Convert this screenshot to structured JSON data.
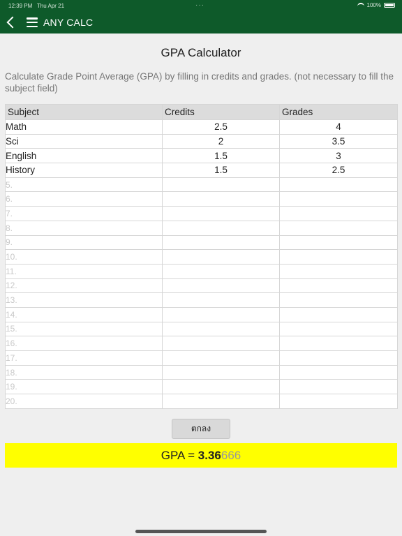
{
  "status": {
    "time": "12:39 PM",
    "date": "Thu Apr 21",
    "dots": "···",
    "battery": "100%"
  },
  "nav": {
    "title": "ANY CALC",
    "icons": [
      "back-icon",
      "menu-icon"
    ]
  },
  "page": {
    "title": "GPA Calculator",
    "description": "Calculate Grade Point Average (GPA) by filling in credits and grades. (not necessary to fill the subject field)"
  },
  "table": {
    "headers": [
      "Subject",
      "Credits",
      "Grades"
    ],
    "rows": [
      {
        "subject": "Math",
        "credits": "2.5",
        "grade": "4"
      },
      {
        "subject": "Sci",
        "credits": "2",
        "grade": "3.5"
      },
      {
        "subject": "English",
        "credits": "1.5",
        "grade": "3"
      },
      {
        "subject": "History",
        "credits": "1.5",
        "grade": "2.5"
      },
      {
        "placeholder": "5."
      },
      {
        "placeholder": "6."
      },
      {
        "placeholder": "7."
      },
      {
        "placeholder": "8."
      },
      {
        "placeholder": "9."
      },
      {
        "placeholder": "10."
      },
      {
        "placeholder": "11."
      },
      {
        "placeholder": "12."
      },
      {
        "placeholder": "13."
      },
      {
        "placeholder": "14."
      },
      {
        "placeholder": "15."
      },
      {
        "placeholder": "16."
      },
      {
        "placeholder": "17."
      },
      {
        "placeholder": "18."
      },
      {
        "placeholder": "19."
      },
      {
        "placeholder": "20."
      }
    ]
  },
  "ok_button_label": "ตกลง",
  "result": {
    "prefix": "GPA = ",
    "bold": "3.36",
    "faint": "666"
  },
  "colors": {
    "appbar": "#0e5a2a",
    "result_bg": "#ffff00"
  }
}
